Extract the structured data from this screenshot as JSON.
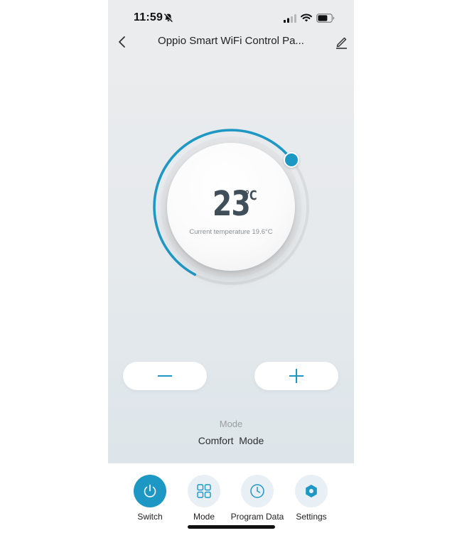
{
  "status_bar": {
    "time": "11:59"
  },
  "header": {
    "title": "Oppio Smart WiFi Control Pa..."
  },
  "thermostat": {
    "set_temp": "23",
    "unit": "℃",
    "current_text": "Current temperature 19.6°C",
    "accent": "#1d98c4"
  },
  "mode": {
    "label": "Mode",
    "value": "Comfort  Mode"
  },
  "tabs": [
    {
      "label": "Switch",
      "icon": "power-icon",
      "active": true
    },
    {
      "label": "Mode",
      "icon": "grid-icon",
      "active": false
    },
    {
      "label": "Program Data",
      "icon": "clock-icon",
      "active": false
    },
    {
      "label": "Settings",
      "icon": "hex-gear-icon",
      "active": false
    }
  ]
}
